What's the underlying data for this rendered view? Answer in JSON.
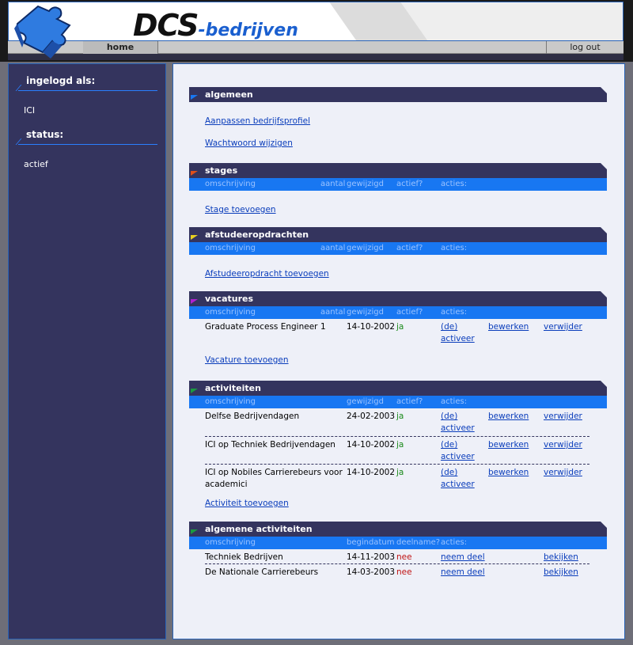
{
  "header": {
    "brand_main": "DCS",
    "brand_sub": "-bedrijven",
    "nav_home": "home",
    "nav_logout": "log out"
  },
  "sidebar": {
    "login_heading": "ingelogd als:",
    "login_value": "ICI",
    "status_heading": "status:",
    "status_value": "actief"
  },
  "algemeen": {
    "title": "algemeen",
    "link_profile": "Aanpassen bedrijfsprofiel",
    "link_password": "Wachtwoord wijzigen"
  },
  "stages": {
    "title": "stages",
    "columns": [
      "omschrijving",
      "aantal",
      "gewijzigd",
      "actief?",
      "acties:"
    ],
    "add_link": "Stage toevoegen"
  },
  "afstudeer": {
    "title": "afstudeeropdrachten",
    "columns": [
      "omschrijving",
      "aantal",
      "gewijzigd",
      "actief?",
      "acties:"
    ],
    "add_link": "Afstudeeropdracht toevoegen"
  },
  "vacatures": {
    "title": "vacatures",
    "columns": [
      "omschrijving",
      "aantal",
      "gewijzigd",
      "actief?",
      "acties:"
    ],
    "rows": [
      {
        "desc": "Graduate Process Engineer",
        "count": "1",
        "date": "14-10-2002",
        "active": "ja",
        "act1a": "(de)",
        "act1b": "activeer",
        "act2": "bewerken",
        "act3": "verwijder"
      }
    ],
    "add_link": "Vacature toevoegen"
  },
  "activiteiten": {
    "title": "activiteiten",
    "columns": [
      "omschrijving",
      "gewijzigd",
      "actief?",
      "acties:"
    ],
    "rows": [
      {
        "desc": "Delfse Bedrijvendagen",
        "date": "24-02-2003",
        "active": "ja",
        "act1a": "(de)",
        "act1b": "activeer",
        "act2": "bewerken",
        "act3": "verwijder"
      },
      {
        "desc": "ICI op Techniek Bedrijvendagen",
        "date": "14-10-2002",
        "active": "ja",
        "act1a": "(de)",
        "act1b": "activeer",
        "act2": "bewerken",
        "act3": "verwijder"
      },
      {
        "desc_a": "ICI op Nobiles Carrierebeurs voor",
        "desc_b": "academici",
        "date": "14-10-2002",
        "active": "ja",
        "act1a": "(de)",
        "act1b": "activeer",
        "act2": "bewerken",
        "act3": "verwijder"
      }
    ],
    "add_link": "Activiteit toevoegen"
  },
  "algemene": {
    "title": "algemene activiteiten",
    "columns": [
      "omschrijving",
      "begindatum",
      "deelname?",
      "acties:"
    ],
    "rows": [
      {
        "desc": "Techniek Bedrijven",
        "date": "14-11-2003",
        "part": "nee",
        "act1": "neem deel",
        "act2": "bekijken"
      },
      {
        "desc": "De Nationale Carrierebeurs",
        "date": "14-03-2003",
        "part": "nee",
        "act1": "neem deel",
        "act2": "bekijken"
      }
    ]
  },
  "colors": {
    "marker_algemeen": "#1877f2",
    "marker_stages": "#e0501a",
    "marker_afstudeer": "#e8d020",
    "marker_vacatures": "#b020d0",
    "marker_activiteiten": "#1a9a40",
    "marker_algemene": "#1a9a40"
  }
}
